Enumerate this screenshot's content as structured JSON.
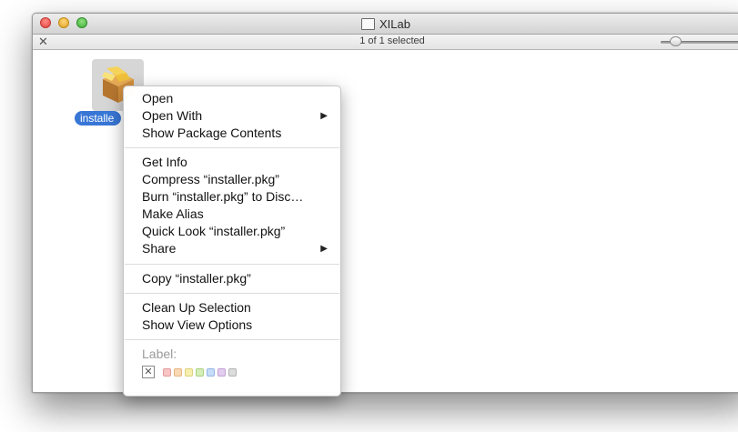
{
  "window": {
    "title": "XILab",
    "status": "1 of 1 selected",
    "icon_size_slider": 0.1
  },
  "file": {
    "name": "installe",
    "icon": "package-icon"
  },
  "context_menu": {
    "group1": [
      {
        "label": "Open",
        "submenu": false
      },
      {
        "label": "Open With",
        "submenu": true
      },
      {
        "label": "Show Package Contents",
        "submenu": false
      }
    ],
    "group2": [
      {
        "label": "Get Info",
        "submenu": false
      },
      {
        "label": "Compress “installer.pkg”",
        "submenu": false
      },
      {
        "label": "Burn “installer.pkg” to Disc…",
        "submenu": false
      },
      {
        "label": "Make Alias",
        "submenu": false
      },
      {
        "label": "Quick Look “installer.pkg”",
        "submenu": false
      },
      {
        "label": "Share",
        "submenu": true
      }
    ],
    "group3": [
      {
        "label": "Copy “installer.pkg”",
        "submenu": false
      }
    ],
    "group4": [
      {
        "label": "Clean Up Selection",
        "submenu": false
      },
      {
        "label": "Show View Options",
        "submenu": false
      }
    ],
    "label_heading": "Label:",
    "label_none_symbol": "✕",
    "label_colors": [
      {
        "name": "red",
        "fill": "#f7c5c5",
        "border": "#e59a9a"
      },
      {
        "name": "orange",
        "fill": "#f8d9b5",
        "border": "#e6b47e"
      },
      {
        "name": "yellow",
        "fill": "#f7efb0",
        "border": "#ddd07a"
      },
      {
        "name": "green",
        "fill": "#d5efb8",
        "border": "#a9cf82"
      },
      {
        "name": "blue",
        "fill": "#c6dcf7",
        "border": "#93b5e3"
      },
      {
        "name": "purple",
        "fill": "#e3cdef",
        "border": "#c1a0d6"
      },
      {
        "name": "gray",
        "fill": "#dcdcdc",
        "border": "#b3b3b3"
      }
    ],
    "submenu_arrow": "▶"
  }
}
